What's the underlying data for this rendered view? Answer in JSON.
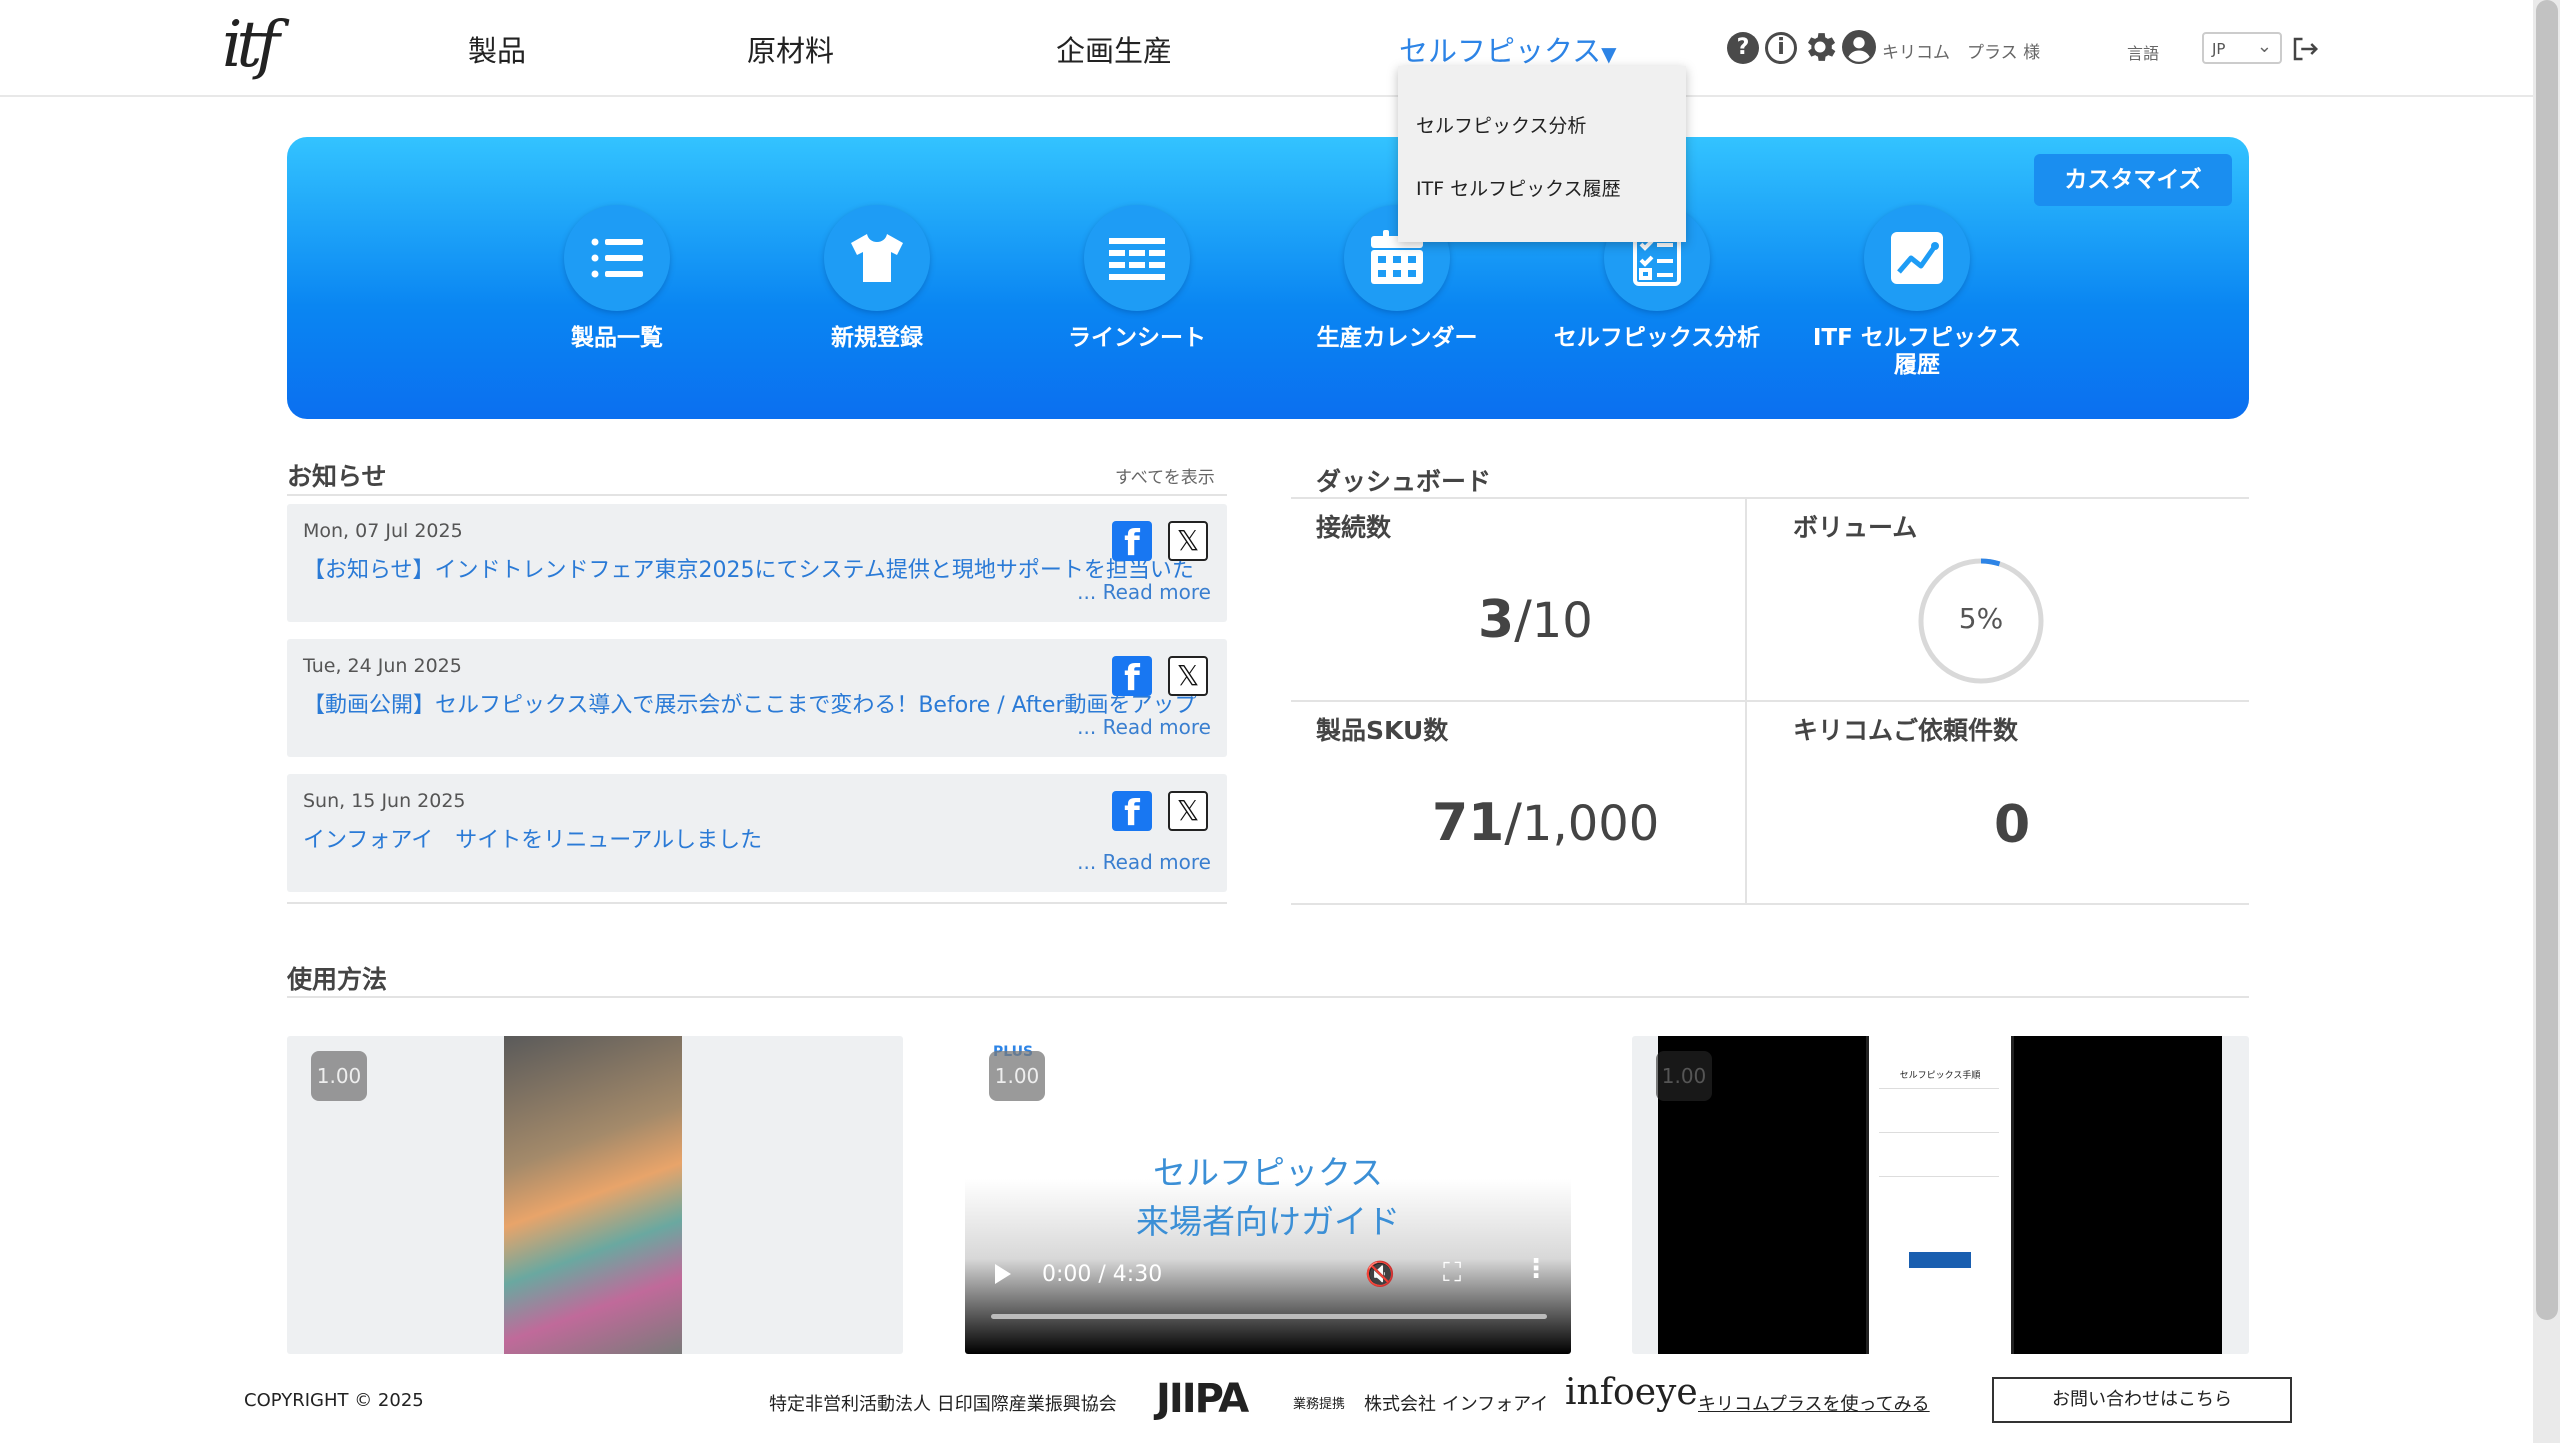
{
  "header": {
    "logo": "itf",
    "nav": [
      "製品",
      "原材料",
      "企画生産",
      "セルフピックス"
    ],
    "user": "キリコム　プラス 様",
    "lang_label": "言語",
    "lang_value": "JP"
  },
  "dropdown": {
    "items": [
      "セルフピックス分析",
      "ITF セルフピックス履歴"
    ]
  },
  "banner": {
    "customize": "カスタマイズ",
    "quick_links": [
      {
        "label": "製品一覧",
        "icon": "list-icon"
      },
      {
        "label": "新規登録",
        "icon": "tshirt-icon"
      },
      {
        "label": "ラインシート",
        "icon": "linesheet-icon"
      },
      {
        "label": "生産カレンダー",
        "icon": "calendar-icon"
      },
      {
        "label": "セルフピックス分析",
        "icon": "checklist-icon"
      },
      {
        "label": "ITF セルフピックス\n履歴",
        "icon": "chart-icon"
      }
    ]
  },
  "news": {
    "title": "お知らせ",
    "see_all": "すべてを表示",
    "items": [
      {
        "date": "Mon, 07 Jul 2025",
        "title": "【お知らせ】インドトレンドフェア東京2025にてシステム提供と現地サポートを担当いた",
        "more": "... Read more"
      },
      {
        "date": "Tue, 24 Jun 2025",
        "title": "【動画公開】セルフピックス導入で展示会がここまで変わる！Before / After動画をアップ",
        "more": "... Read more"
      },
      {
        "date": "Sun, 15 Jun 2025",
        "title": "インフォアイ　サイトをリニューアルしました",
        "more": "... Read more"
      }
    ]
  },
  "dashboard": {
    "title": "ダッシュボード",
    "connections": {
      "label": "接続数",
      "value": "3",
      "max": "10"
    },
    "volume": {
      "label": "ボリューム",
      "percent_text": "5%",
      "percent": 5
    },
    "sku": {
      "label": "製品SKU数",
      "value": "71",
      "max": "1,000"
    },
    "requests": {
      "label": "キリコムご依頼件数",
      "value": "0"
    }
  },
  "usage": {
    "title": "使用方法",
    "videos": [
      {
        "speed": "1.00"
      },
      {
        "speed": "1.00",
        "caption_line1": "セルフピックス",
        "caption_line2": "来場者向けガイド",
        "time": "0:00 / 4:30",
        "brand": "PLUS"
      },
      {
        "speed": "1.00",
        "phone_title": "セルフピックス手順"
      }
    ]
  },
  "footer": {
    "copyright": "COPYRIGHT © 2025",
    "org": "特定非営利活動法人 日印国際産業振興協会",
    "jiipa": "JIIPA",
    "service_label": "業務提携",
    "company": "株式会社 インフォアイ",
    "infoeye": "infoeye",
    "try_link": "キリコムプラスを使ってみる",
    "contact": "お問い合わせはこちら"
  },
  "colors": {
    "accent": "#2d84e6",
    "banner_top": "#33c3ff",
    "banner_bottom": "#0b6ff0",
    "link": "#2a7ad6"
  }
}
